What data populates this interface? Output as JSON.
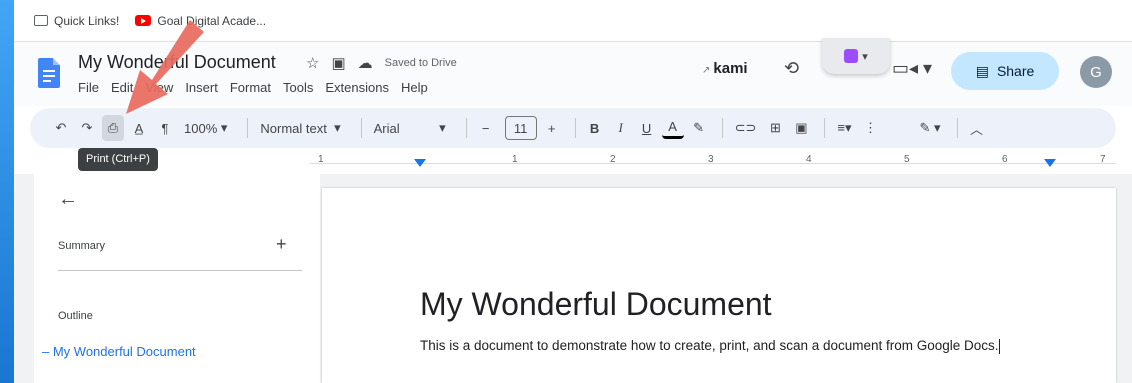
{
  "bookmarks": [
    {
      "label": "Quick Links!"
    },
    {
      "label": "Goal Digital Acade..."
    }
  ],
  "header": {
    "doc_title": "My Wonderful Document",
    "saved_status": "Saved to Drive",
    "kami_label": "kami",
    "share_label": "Share",
    "avatar_letter": "G"
  },
  "menu": [
    "File",
    "Edit",
    "View",
    "Insert",
    "Format",
    "Tools",
    "Extensions",
    "Help"
  ],
  "toolbar": {
    "zoom": "100%",
    "style": "Normal text",
    "font": "Arial",
    "font_size": "11",
    "tooltip": "Print (Ctrl+P)"
  },
  "ruler": {
    "numbers": [
      "1",
      "1",
      "2",
      "3",
      "4",
      "5",
      "6",
      "7"
    ]
  },
  "sidebar": {
    "summary_label": "Summary",
    "outline_label": "Outline",
    "outline_items": [
      "My Wonderful Document"
    ]
  },
  "document": {
    "heading": "My Wonderful Document",
    "body": "This is a document to demonstrate how to create, print, and scan a document from Google Docs."
  },
  "colors": {
    "accent": "#1a73e8",
    "share_bg": "#c2e7ff",
    "annotation_arrow": "#e86a5e"
  }
}
